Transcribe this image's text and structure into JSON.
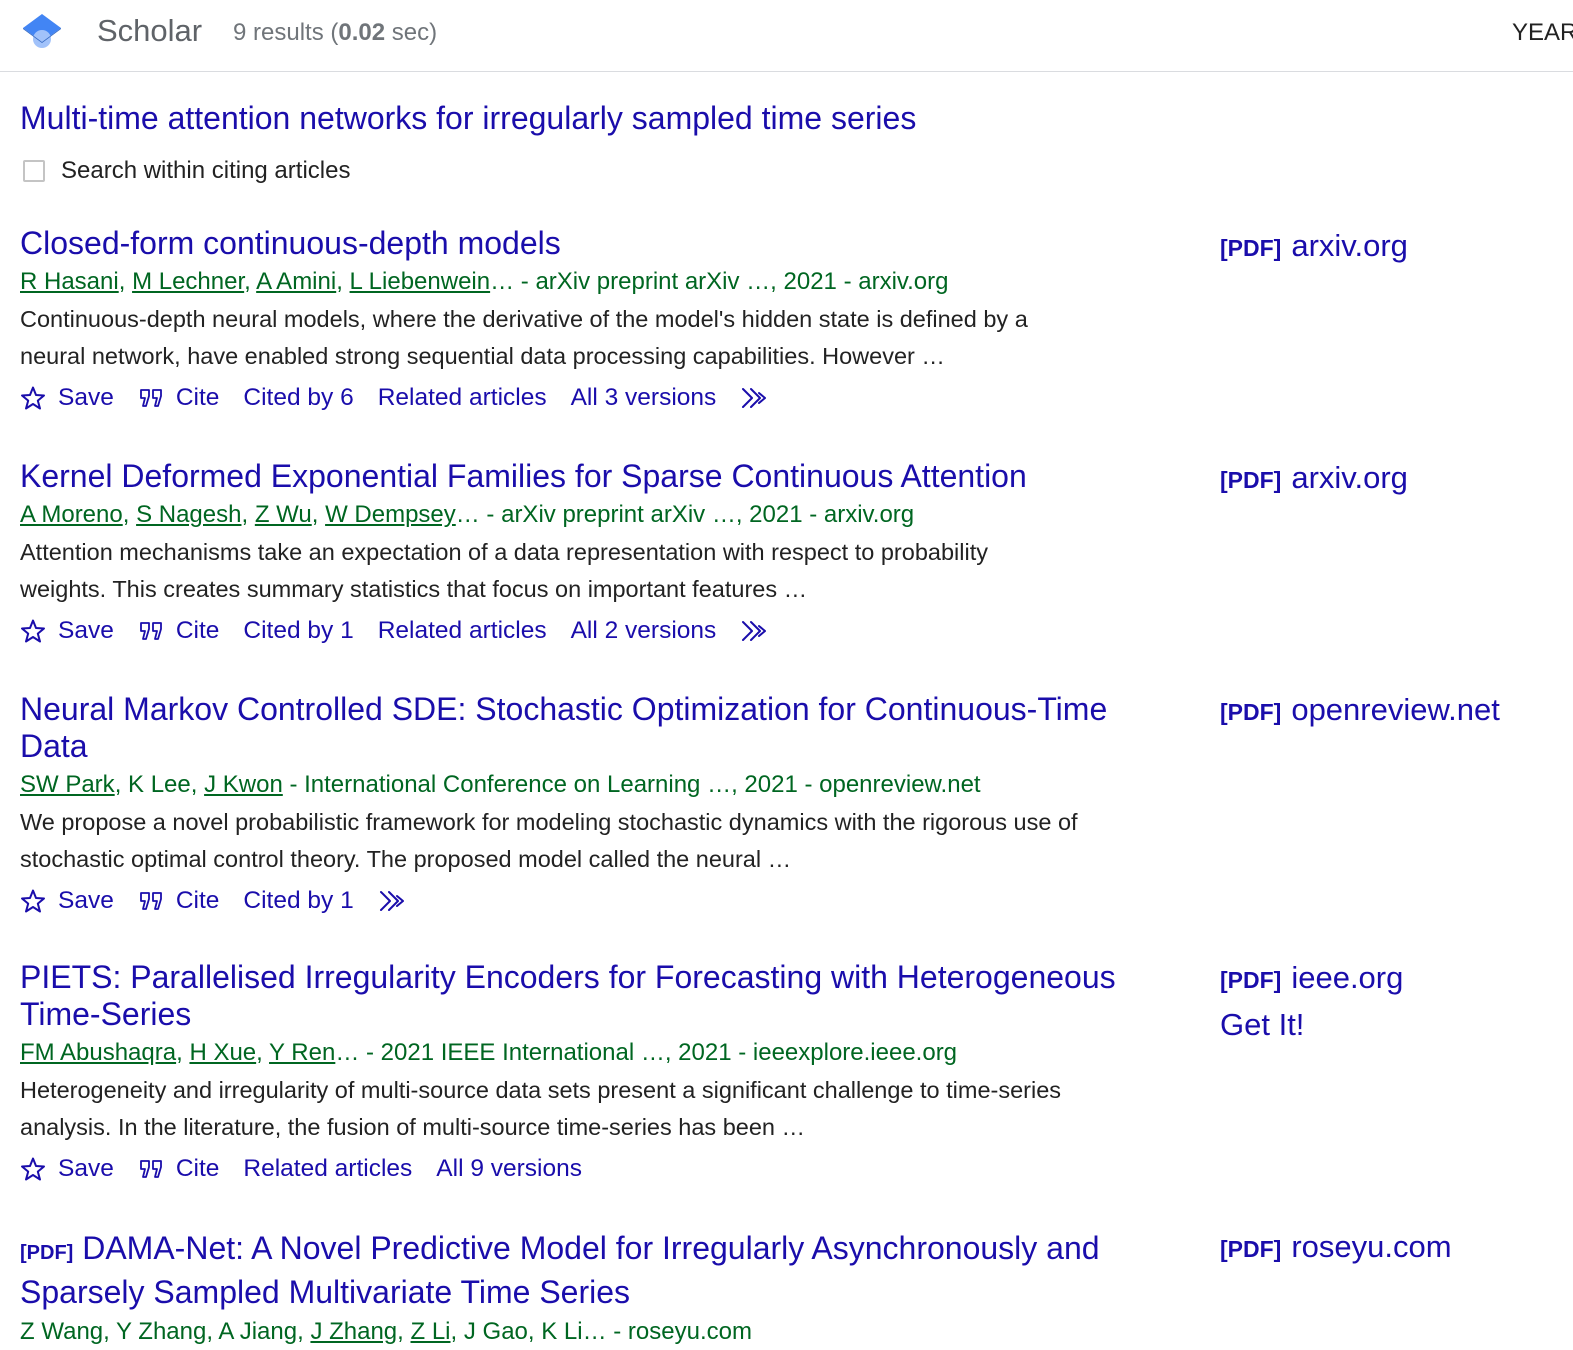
{
  "header": {
    "brand": "Scholar",
    "results_prefix": "9 results (",
    "results_time": "0.02",
    "results_suffix": " sec)",
    "year_label": "YEAR"
  },
  "cited_article": {
    "title": "Multi-time attention networks for irregularly sampled time series",
    "search_within_label": "Search within citing articles"
  },
  "actions": {
    "save": "Save",
    "cite": "Cite"
  },
  "results": [
    {
      "title": "Closed-form continuous-depth models",
      "authors": [
        "R Hasani",
        "M Lechner",
        "A Amini",
        "L Liebenwein"
      ],
      "source": "… - arXiv preprint arXiv …, 2021 - arxiv.org",
      "snippet": "Continuous-depth neural models, where the derivative of the model's hidden state is defined by a neural network, have enabled strong sequential data processing capabilities. However …",
      "cited_by": "Cited by 6",
      "related": "Related articles",
      "versions": "All 3 versions",
      "side_tag": "[PDF]",
      "side_domain": "arxiv.org"
    },
    {
      "title": "Kernel Deformed Exponential Families for Sparse Continuous Attention",
      "authors": [
        "A Moreno",
        "S Nagesh",
        "Z Wu",
        "W Dempsey"
      ],
      "source": "… - arXiv preprint arXiv …, 2021 - arxiv.org",
      "snippet": "Attention mechanisms take an expectation of a data representation with respect to probability weights. This creates summary statistics that focus on important features …",
      "cited_by": "Cited by 1",
      "related": "Related articles",
      "versions": "All 2 versions",
      "side_tag": "[PDF]",
      "side_domain": "arxiv.org"
    },
    {
      "title": "Neural Markov Controlled SDE: Stochastic Optimization for Continuous-Time Data",
      "author_parts": [
        "SW Park",
        "K Lee",
        "J Kwon"
      ],
      "source": " - International Conference on Learning …, 2021 - openreview.net",
      "snippet": "We propose a novel probabilistic framework for modeling stochastic dynamics with the rigorous use of stochastic optimal control theory. The proposed model called the neural …",
      "cited_by": "Cited by 1",
      "side_tag": "[PDF]",
      "side_domain": "openreview.net"
    },
    {
      "title": "PIETS: Parallelised Irregularity Encoders for Forecasting with Heterogeneous Time-Series",
      "authors": [
        "FM Abushaqra",
        "H Xue",
        "Y Ren"
      ],
      "source": "… - 2021 IEEE International …, 2021 - ieeexplore.ieee.org",
      "snippet": "Heterogeneity and irregularity of multi-source data sets present a significant challenge to time-series analysis. In the literature, the fusion of multi-source time-series has been …",
      "related": "Related articles",
      "versions": "All 9 versions",
      "side_tag": "[PDF]",
      "side_domain": "ieee.org",
      "side_extra": "Get It!"
    },
    {
      "title_tag": "[PDF]",
      "title": "DAMA-Net: A Novel Predictive Model for Irregularly Asynchronously and Sparsely Sampled Multivariate Time Series",
      "author_parts": [
        "Z Wang",
        "Y Zhang",
        "A Jiang",
        "J Zhang",
        "Z Li",
        "J Gao",
        "K Li"
      ],
      "source": "… - roseyu.com",
      "side_tag": "[PDF]",
      "side_domain": "roseyu.com"
    }
  ]
}
